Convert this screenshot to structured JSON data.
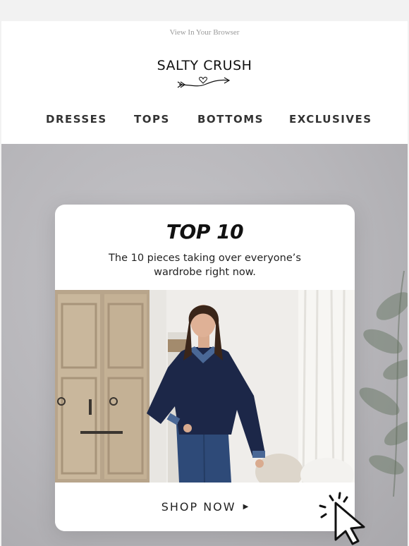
{
  "header": {
    "view_in_browser": "View In Your Browser",
    "logo_text": "SALTY CRUSH"
  },
  "nav": {
    "items": [
      {
        "label": "DRESSES"
      },
      {
        "label": "TOPS"
      },
      {
        "label": "BOTTOMS"
      },
      {
        "label": "EXCLUSIVES"
      }
    ]
  },
  "card": {
    "title": "TOP 10",
    "subtitle": "The 10 pieces taking over everyone’s wardrobe right now.",
    "cta_label": "SHOP NOW",
    "cta_arrow": "▶"
  },
  "icons": {
    "logo_arrow": "heart-arrow-icon",
    "cursor": "click-cursor-icon",
    "cta_arrow": "triangle-right-icon"
  },
  "colors": {
    "page_bg": "#f2f2f2",
    "hero_bg": "#b8b7bb",
    "text": "#222222",
    "sweater": "#1c2748",
    "jeans": "#2e4a78"
  }
}
